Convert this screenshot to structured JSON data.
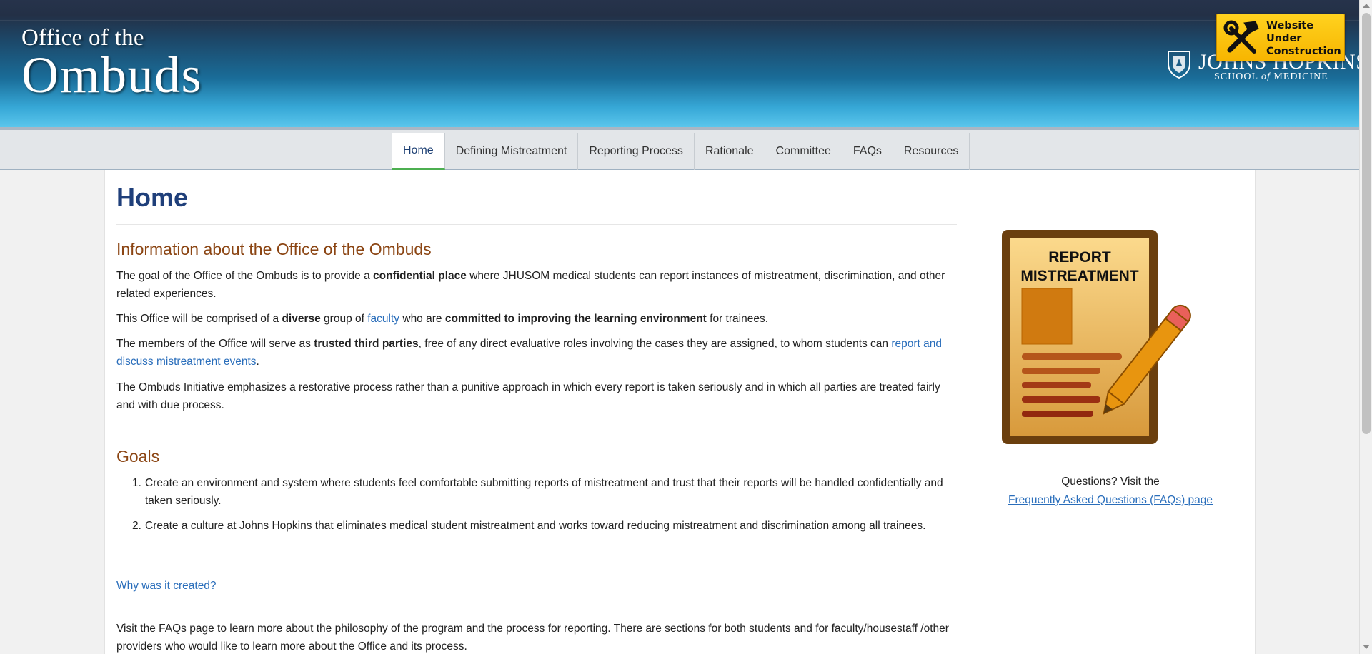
{
  "header": {
    "logo_line1": "Office of the",
    "logo_line2": "Ombuds",
    "jhu_name": "JOHNS HOPKINS",
    "jhu_sub_prefix": "SCHOOL",
    "jhu_sub_of": "of",
    "jhu_sub_suffix": "MEDICINE",
    "construction_badge": "Website Under Construction",
    "construction_lines": [
      "Website",
      "Under",
      "Construction"
    ]
  },
  "nav": {
    "items": [
      {
        "label": "Home",
        "active": true
      },
      {
        "label": "Defining Mistreatment",
        "active": false
      },
      {
        "label": "Reporting Process",
        "active": false
      },
      {
        "label": "Rationale",
        "active": false
      },
      {
        "label": "Committee",
        "active": false
      },
      {
        "label": "FAQs",
        "active": false
      },
      {
        "label": "Resources",
        "active": false
      }
    ]
  },
  "main": {
    "title": "Home",
    "info_heading": "Information about the Office of the Ombuds",
    "p1": {
      "before": "The goal of the Office of the Ombuds is to provide a ",
      "bold": "confidential place",
      "after": " where JHUSOM medical students can report instances of mistreatment, discrimination, and other related experiences."
    },
    "p2": {
      "before": "This Office will be comprised of a ",
      "bold1": "diverse",
      "mid1": " group of ",
      "link": "faculty",
      "mid2": " who are ",
      "bold2": "committed to improving the learning environment",
      "after": " for trainees."
    },
    "p3": {
      "before": "The members of the Office will serve as ",
      "bold": "trusted third parties",
      "mid": ", free of any direct evaluative roles involving the cases they are assigned, to whom students can ",
      "link": "report and discuss mistreatment events",
      "after": "."
    },
    "p4": "The Ombuds Initiative emphasizes a restorative process rather than a punitive approach in which every report is taken seriously and in which all parties are treated fairly and with due process.",
    "goals_heading": "Goals",
    "goals": [
      {
        "num": "1.",
        "text": "Create an environment and system where students feel comfortable submitting reports of mistreatment and trust that their reports will be handled confidentially and taken seriously."
      },
      {
        "num": "2.",
        "text": "Create a culture at Johns Hopkins that eliminates medical student mistreatment and works toward reducing mistreatment and discrimination among all trainees."
      }
    ],
    "why_link": "Why was it created?",
    "p5": "Visit the FAQs page to learn more about the philosophy of the program and the process for reporting. There are sections for both students and for faculty/housestaff /other providers who would like to learn more about the Office and its process."
  },
  "sidebar": {
    "image_text_line1": "REPORT",
    "image_text_line2": "MISTREATMENT",
    "questions_text": "Questions? Visit the",
    "faq_link": "Frequently Asked Questions (FAQs) page"
  },
  "colors": {
    "title_blue": "#1f3f7a",
    "heading_brown": "#8b4513",
    "link_blue": "#2a6ebb",
    "nav_active_underline": "#4caf50",
    "badge_yellow": "#ffd21f"
  }
}
